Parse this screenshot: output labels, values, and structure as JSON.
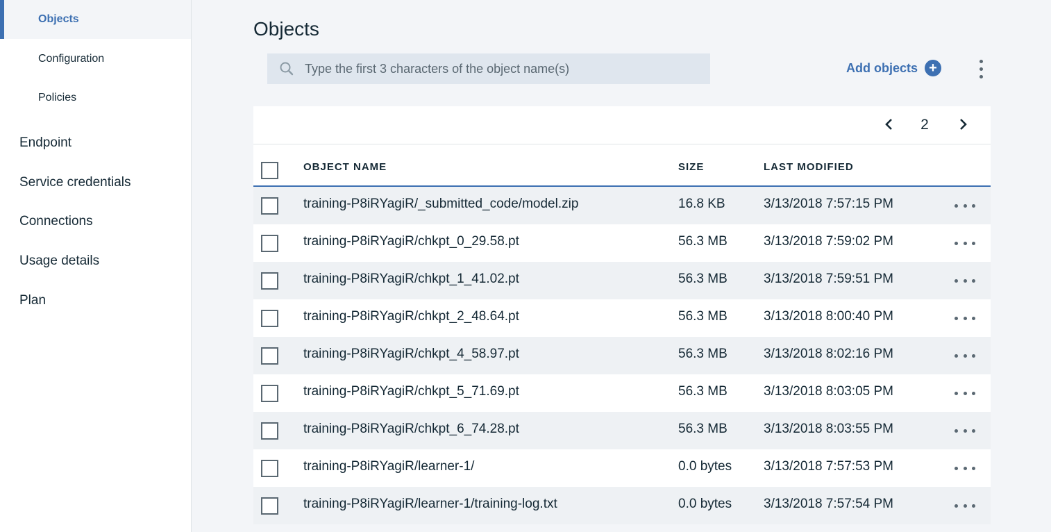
{
  "sidebar": {
    "sub_items": [
      {
        "label": "Objects",
        "active": true
      },
      {
        "label": "Configuration",
        "active": false
      },
      {
        "label": "Policies",
        "active": false
      }
    ],
    "main_items": [
      {
        "label": "Endpoint"
      },
      {
        "label": "Service credentials"
      },
      {
        "label": "Connections"
      },
      {
        "label": "Usage details"
      },
      {
        "label": "Plan"
      }
    ]
  },
  "main": {
    "title": "Objects",
    "search": {
      "placeholder": "Type the first 3 characters of the object name(s)",
      "value": "",
      "icon": "search-icon"
    },
    "add_objects_label": "Add objects",
    "add_icon": "plus-circle-icon",
    "overflow_icon": "kebab-vertical-icon"
  },
  "pagination": {
    "page": "2"
  },
  "table": {
    "headers": {
      "name": "OBJECT NAME",
      "size": "SIZE",
      "modified": "LAST MODIFIED"
    },
    "rows": [
      {
        "name": "training-P8iRYagiR/_submitted_code/model.zip",
        "size": "16.8 KB",
        "modified": "3/13/2018 7:57:15 PM"
      },
      {
        "name": "training-P8iRYagiR/chkpt_0_29.58.pt",
        "size": "56.3 MB",
        "modified": "3/13/2018 7:59:02 PM"
      },
      {
        "name": "training-P8iRYagiR/chkpt_1_41.02.pt",
        "size": "56.3 MB",
        "modified": "3/13/2018 7:59:51 PM"
      },
      {
        "name": "training-P8iRYagiR/chkpt_2_48.64.pt",
        "size": "56.3 MB",
        "modified": "3/13/2018 8:00:40 PM"
      },
      {
        "name": "training-P8iRYagiR/chkpt_4_58.97.pt",
        "size": "56.3 MB",
        "modified": "3/13/2018 8:02:16 PM"
      },
      {
        "name": "training-P8iRYagiR/chkpt_5_71.69.pt",
        "size": "56.3 MB",
        "modified": "3/13/2018 8:03:05 PM"
      },
      {
        "name": "training-P8iRYagiR/chkpt_6_74.28.pt",
        "size": "56.3 MB",
        "modified": "3/13/2018 8:03:55 PM"
      },
      {
        "name": "training-P8iRYagiR/learner-1/",
        "size": "0.0 bytes",
        "modified": "3/13/2018 7:57:53 PM"
      },
      {
        "name": "training-P8iRYagiR/learner-1/training-log.txt",
        "size": "0.0 bytes",
        "modified": "3/13/2018 7:57:54 PM"
      }
    ]
  },
  "colors": {
    "accent": "#3d70b2",
    "text": "#152935",
    "background": "#f3f5f8"
  }
}
